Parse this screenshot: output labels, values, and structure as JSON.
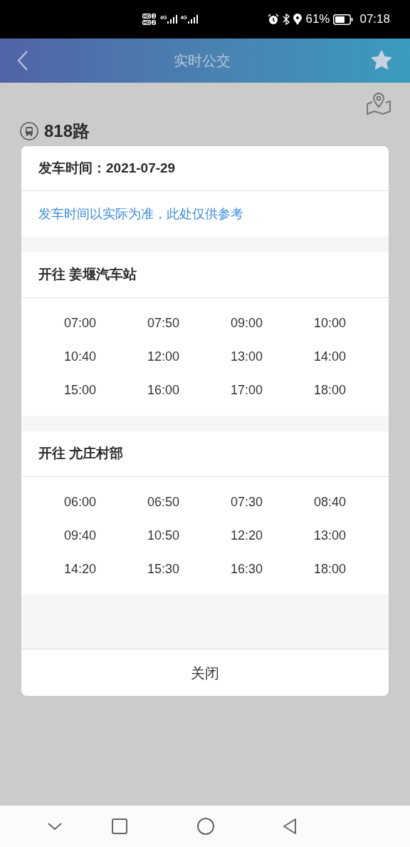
{
  "status_bar": {
    "sims": [
      {
        "hd": "HD",
        "slot": "1",
        "network": "4G"
      },
      {
        "hd": "HD",
        "slot": "2",
        "network": "4G"
      }
    ],
    "battery_percent": "61%",
    "time": "07:18"
  },
  "header": {
    "title": "实时公交"
  },
  "route": {
    "name": "818路"
  },
  "dialog": {
    "departure": "发车时间：2021-07-29",
    "note": "发车时间以实际为准，此处仅供参考",
    "sections": [
      {
        "title": "开往 姜堰汽车站",
        "times": [
          "07:00",
          "07:50",
          "09:00",
          "10:00",
          "10:40",
          "12:00",
          "13:00",
          "14:00",
          "15:00",
          "16:00",
          "17:00",
          "18:00"
        ]
      },
      {
        "title": "开往 尤庄村部",
        "times": [
          "06:00",
          "06:50",
          "07:30",
          "08:40",
          "09:40",
          "10:50",
          "12:20",
          "13:00",
          "14:20",
          "15:30",
          "16:30",
          "18:00"
        ]
      }
    ],
    "close": "关闭"
  }
}
